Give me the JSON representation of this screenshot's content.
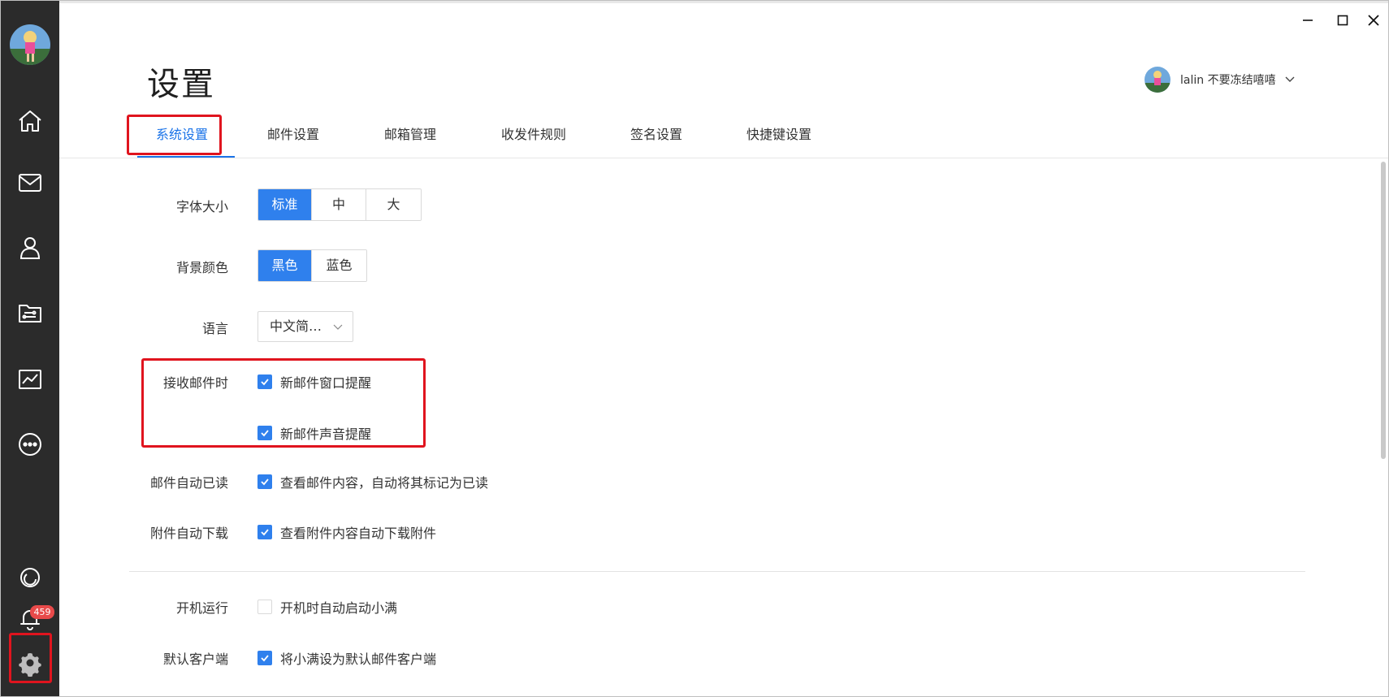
{
  "window": {
    "minimize_icon": "minimize-icon",
    "maximize_icon": "maximize-icon",
    "close_icon": "close-icon"
  },
  "sidebar": {
    "items": [
      {
        "name": "home",
        "icon": "home-icon"
      },
      {
        "name": "mail",
        "icon": "mail-icon"
      },
      {
        "name": "contacts",
        "icon": "user-icon"
      },
      {
        "name": "folders",
        "icon": "folder-icon"
      },
      {
        "name": "statistics",
        "icon": "chart-icon"
      },
      {
        "name": "more",
        "icon": "more-icon"
      }
    ],
    "bottom": {
      "theme_icon": "theme-icon",
      "notification_icon": "bell-icon",
      "notification_count": "459",
      "settings_icon": "gear-icon"
    }
  },
  "header": {
    "title": "设置",
    "user_name": "lalin 不要冻结嘻嘻"
  },
  "tabs": [
    {
      "label": "系统设置",
      "active": true
    },
    {
      "label": "邮件设置",
      "active": false
    },
    {
      "label": "邮箱管理",
      "active": false
    },
    {
      "label": "收发件规则",
      "active": false
    },
    {
      "label": "签名设置",
      "active": false
    },
    {
      "label": "快捷键设置",
      "active": false
    }
  ],
  "settings": {
    "font_size": {
      "label": "字体大小",
      "options": [
        "标准",
        "中",
        "大"
      ],
      "selected": "标准"
    },
    "background": {
      "label": "背景颜色",
      "options": [
        "黑色",
        "蓝色"
      ],
      "selected": "黑色"
    },
    "language": {
      "label": "语言",
      "value": "中文简…"
    },
    "on_receive": {
      "label": "接收邮件时",
      "options": [
        {
          "text": "新邮件窗口提醒",
          "checked": true
        },
        {
          "text": "新邮件声音提醒",
          "checked": true
        }
      ]
    },
    "auto_read": {
      "label": "邮件自动已读",
      "text": "查看邮件内容，自动将其标记为已读",
      "checked": true
    },
    "auto_download": {
      "label": "附件自动下载",
      "text": "查看附件内容自动下载附件",
      "checked": true
    },
    "startup": {
      "label": "开机运行",
      "text": "开机时自动启动小满",
      "checked": false
    },
    "default_client": {
      "label": "默认客户端",
      "text": "将小满设为默认邮件客户端",
      "checked": true
    }
  },
  "colors": {
    "accent": "#2f80ed",
    "sidebar_bg": "#2b2b2b",
    "highlight": "#e0141e",
    "badge": "#e84a4a"
  }
}
